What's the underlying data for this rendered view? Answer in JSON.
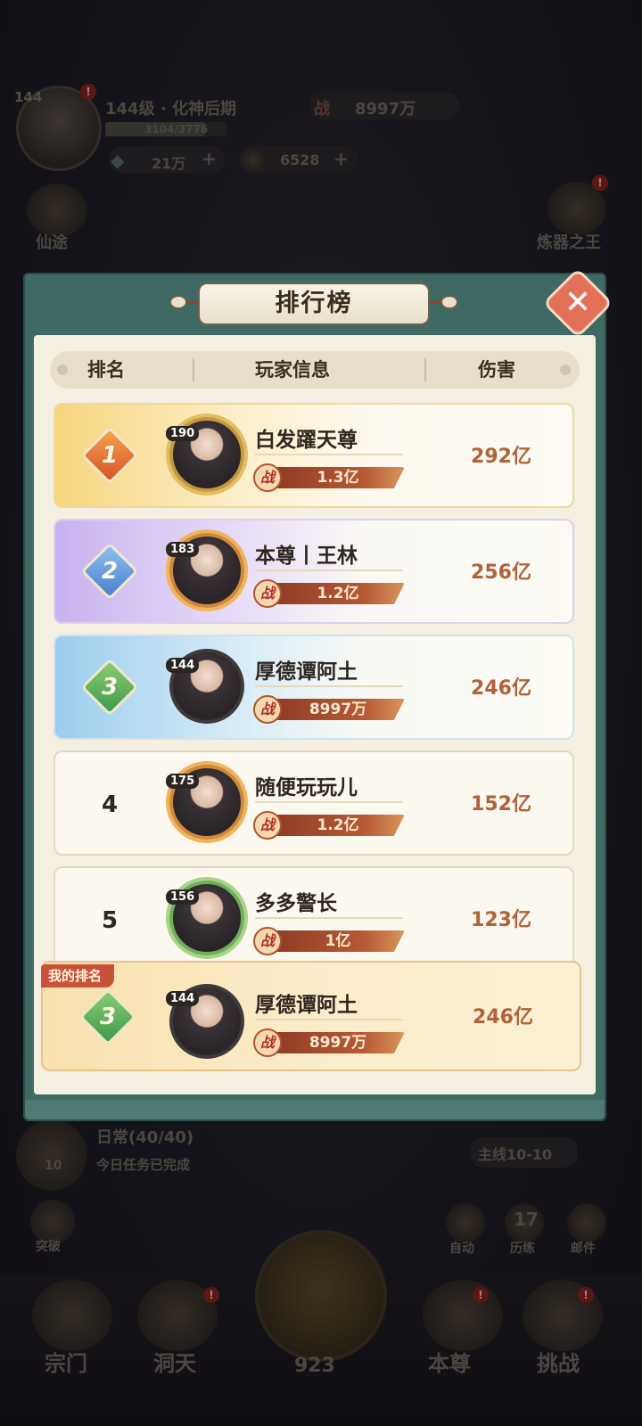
{
  "hud": {
    "avatar_level": "144",
    "level_title": "144级 · 化神后期",
    "exp": "3104/3776",
    "power_label": "战",
    "power": "8997万",
    "gems": "21万",
    "coins": "6528",
    "plus": "+",
    "left_icon_label": "仙途",
    "right_icon_label": "炼器之王",
    "daily_title": "日常(40/40)",
    "daily_sub": "今日任务已完成",
    "daily_count": "10",
    "mainline": "主线10-10",
    "breakthrough": "突破",
    "auto": "自动",
    "trials_count": "17",
    "trials": "历练",
    "mail": "邮件",
    "nav": [
      "宗门",
      "洞天",
      "本尊",
      "挑战"
    ],
    "center_count": "923"
  },
  "modal": {
    "title": "排行榜",
    "close": "✕",
    "headers": {
      "rank": "排名",
      "player": "玩家信息",
      "damage": "伤害"
    },
    "my_rank_tag": "我的排名",
    "power_icon": "战"
  },
  "rows": [
    {
      "rank": "1",
      "level": "190",
      "name": "白发躍天尊",
      "power": "1.3亿",
      "damage": "292亿"
    },
    {
      "rank": "2",
      "level": "183",
      "name": "本尊丨王林",
      "power": "1.2亿",
      "damage": "256亿"
    },
    {
      "rank": "3",
      "level": "144",
      "name": "厚德谭阿土",
      "power": "8997万",
      "damage": "246亿"
    },
    {
      "rank": "4",
      "level": "175",
      "name": "随便玩玩儿",
      "power": "1.2亿",
      "damage": "152亿"
    },
    {
      "rank": "5",
      "level": "156",
      "name": "多多警长",
      "power": "1亿",
      "damage": "123亿"
    }
  ],
  "mine": {
    "rank": "3",
    "level": "144",
    "name": "厚德谭阿土",
    "power": "8997万",
    "damage": "246亿"
  },
  "colors": {
    "modal_teal": "#3f6a63",
    "damage": "#b0623a",
    "power_bar": "#b65a35"
  }
}
